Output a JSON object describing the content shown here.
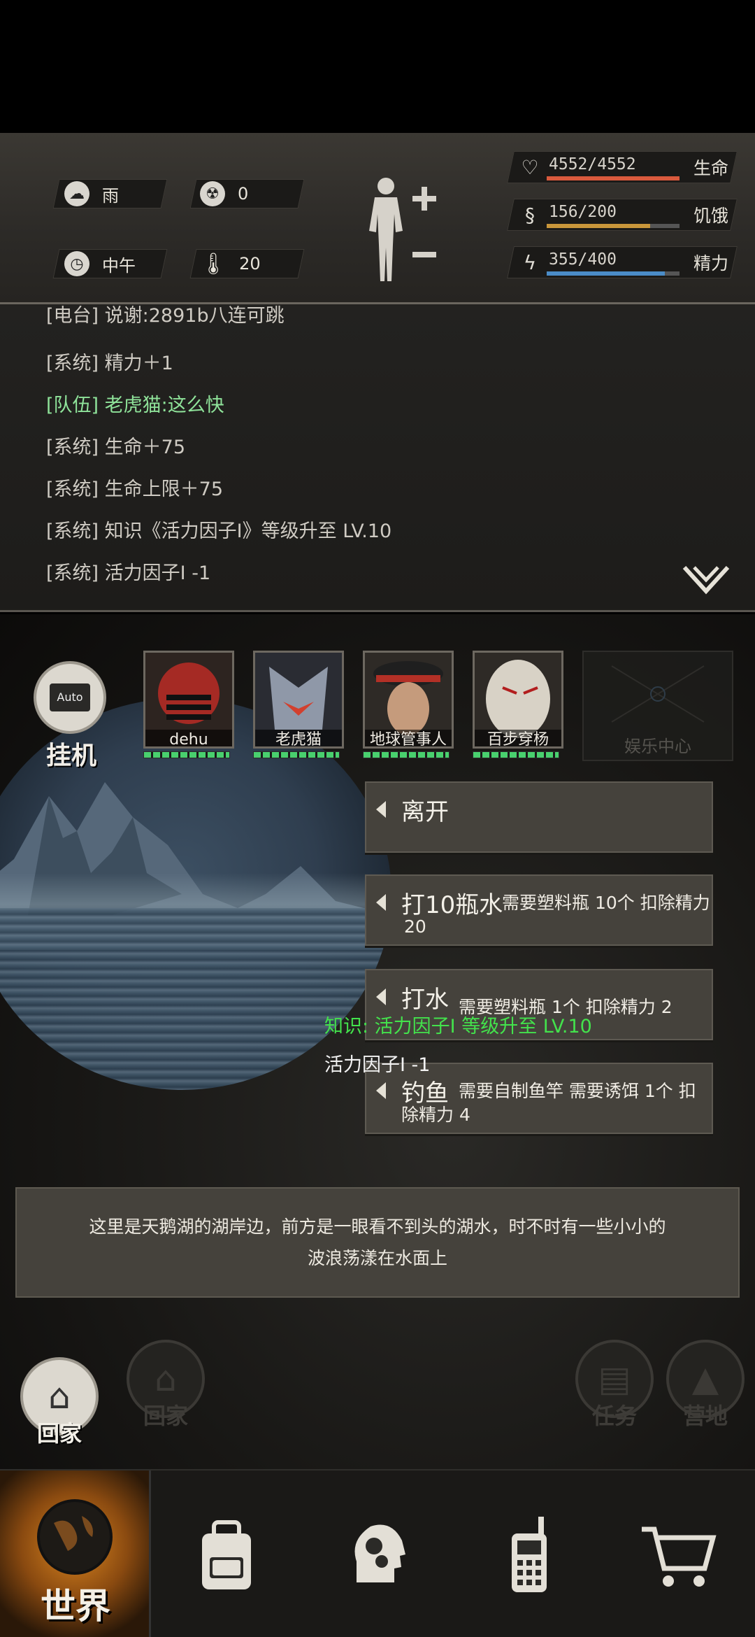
{
  "weather": {
    "condition": "雨",
    "radiation": "0",
    "time_of_day": "中午",
    "temperature": "20"
  },
  "stats": {
    "health": {
      "label": "生命",
      "value": "4552/4552",
      "fraction": 1.0,
      "color": "#d95a3d"
    },
    "hunger": {
      "label": "饥饿",
      "value": "156/200",
      "fraction": 0.78,
      "color": "#c9963a"
    },
    "energy": {
      "label": "精力",
      "value": "355/400",
      "fraction": 0.8875,
      "color": "#4b8cc7"
    }
  },
  "log": [
    {
      "text": "[电台] 说谢:2891b八连可跳",
      "green": false
    },
    {
      "text": "[系统] 精力＋1",
      "green": false
    },
    {
      "text": "[队伍] 老虎猫:这么快",
      "green": true
    },
    {
      "text": "[系统] 生命＋75",
      "green": false
    },
    {
      "text": "[系统] 生命上限＋75",
      "green": false
    },
    {
      "text": "[系统] 知识《活力因子Ⅰ》等级升至 LV.10",
      "green": false
    },
    {
      "text": "[系统] 活力因子Ⅰ -1",
      "green": false
    }
  ],
  "auto": {
    "screen": "Auto",
    "label": "挂机"
  },
  "team": [
    {
      "name": "dehu"
    },
    {
      "name": "老虎猫"
    },
    {
      "name": "地球管事人"
    },
    {
      "name": "百步穿杨"
    }
  ],
  "entertainment": {
    "label": "娱乐中心"
  },
  "actions": [
    {
      "title": "离开",
      "desc": ""
    },
    {
      "title": "打10瓶水",
      "desc": "需要塑料瓶 10个 扣除精力",
      "desc2": "20"
    },
    {
      "title": "打水",
      "desc": "需要塑料瓶 1个 扣除精力 2",
      "desc2": ""
    },
    {
      "title": "钓鱼",
      "desc": "需要自制鱼竿 需要诱饵 1个 扣",
      "desc2": "除精力 4"
    }
  ],
  "floating": {
    "knowledge": "知识: 活力因子Ⅰ 等级升至 LV.10",
    "item": "活力因子Ⅰ -1"
  },
  "description": {
    "line1": "这里是天鹅湖的湖岸边，前方是一眼看不到头的湖水，时不时有一些小小的",
    "line2": "波浪荡漾在水面上"
  },
  "bottom_buttons": {
    "home_active": "回家",
    "home": "回家",
    "task": "任务",
    "camp": "营地"
  },
  "tabs": {
    "world": "世界"
  }
}
